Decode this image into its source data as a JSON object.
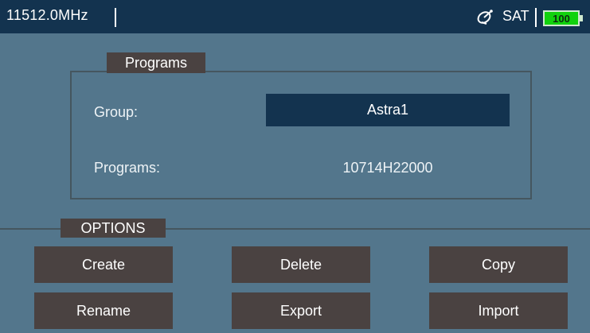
{
  "status_bar": {
    "frequency": "11512.0MHz",
    "satellite_icon": "satellite-dish-icon",
    "mode": "SAT",
    "battery_percent": "100",
    "battery_color": "#11d20d"
  },
  "programs_section": {
    "title": "Programs",
    "group_label": "Group:",
    "group_value": "Astra1",
    "programs_label": "Programs:",
    "programs_value": "10714H22000"
  },
  "options_section": {
    "title": "OPTIONS",
    "buttons": [
      "Create",
      "Delete",
      "Copy",
      "Rename",
      "Export",
      "Import"
    ]
  },
  "colors": {
    "background": "#53768c",
    "header": "#13334f",
    "button": "#4a4241"
  }
}
